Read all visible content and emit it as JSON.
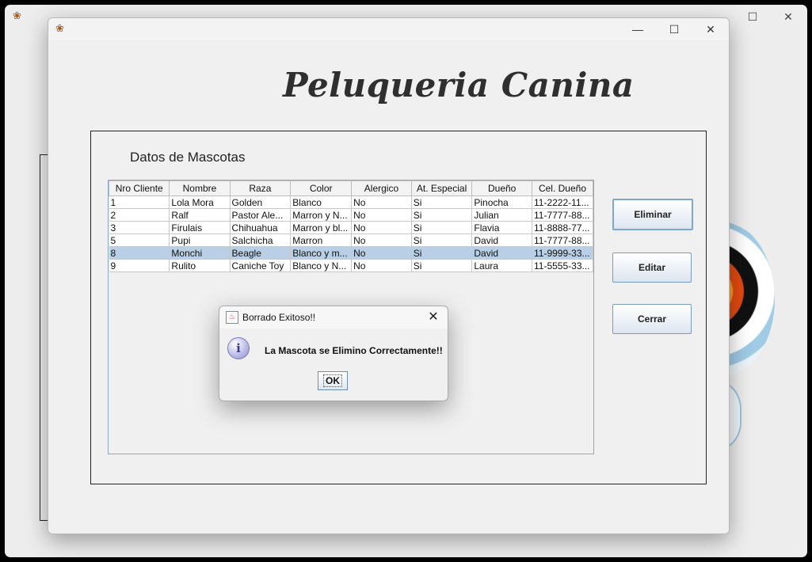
{
  "background_window": {
    "controls": [
      "—",
      "☐",
      "✕"
    ]
  },
  "main_window": {
    "controls": [
      "—",
      "☐",
      "✕"
    ],
    "app_title": "Peluqueria Canina",
    "panel_title": "Datos de Mascotas",
    "table": {
      "columns": [
        "Nro Cliente",
        "Nombre",
        "Raza",
        "Color",
        "Alergico",
        "At. Especial",
        "Dueño",
        "Cel. Dueño"
      ],
      "rows": [
        [
          "1",
          "Lola Mora",
          "Golden",
          "Blanco",
          "No",
          "Si",
          "Pinocha",
          "11-2222-11..."
        ],
        [
          "2",
          "Ralf",
          "Pastor Ale...",
          "Marron y N...",
          "No",
          "Si",
          "Julian",
          "11-7777-88..."
        ],
        [
          "3",
          "Firulais",
          "Chihuahua",
          "Marron y bl...",
          "No",
          "Si",
          "Flavia",
          "11-8888-77..."
        ],
        [
          "5",
          "Pupi",
          "Salchicha",
          "Marron",
          "No",
          "Si",
          "David",
          "11-7777-88..."
        ],
        [
          "8",
          "Monchi",
          "Beagle",
          "Blanco y m...",
          "No",
          "Si",
          "David",
          "11-9999-33..."
        ],
        [
          "9",
          "Rulito",
          "Caniche Toy",
          "Blanco y N...",
          "No",
          "Si",
          "Laura",
          "11-5555-33..."
        ]
      ],
      "selected_row_index": 4
    },
    "buttons": {
      "eliminar": "Eliminar",
      "editar": "Editar",
      "cerrar": "Cerrar"
    }
  },
  "dialog": {
    "title": "Borrado Exitoso!!",
    "message": "La Mascota se Elimino Correctamente!!",
    "ok": "OK",
    "icon": "information-icon"
  }
}
